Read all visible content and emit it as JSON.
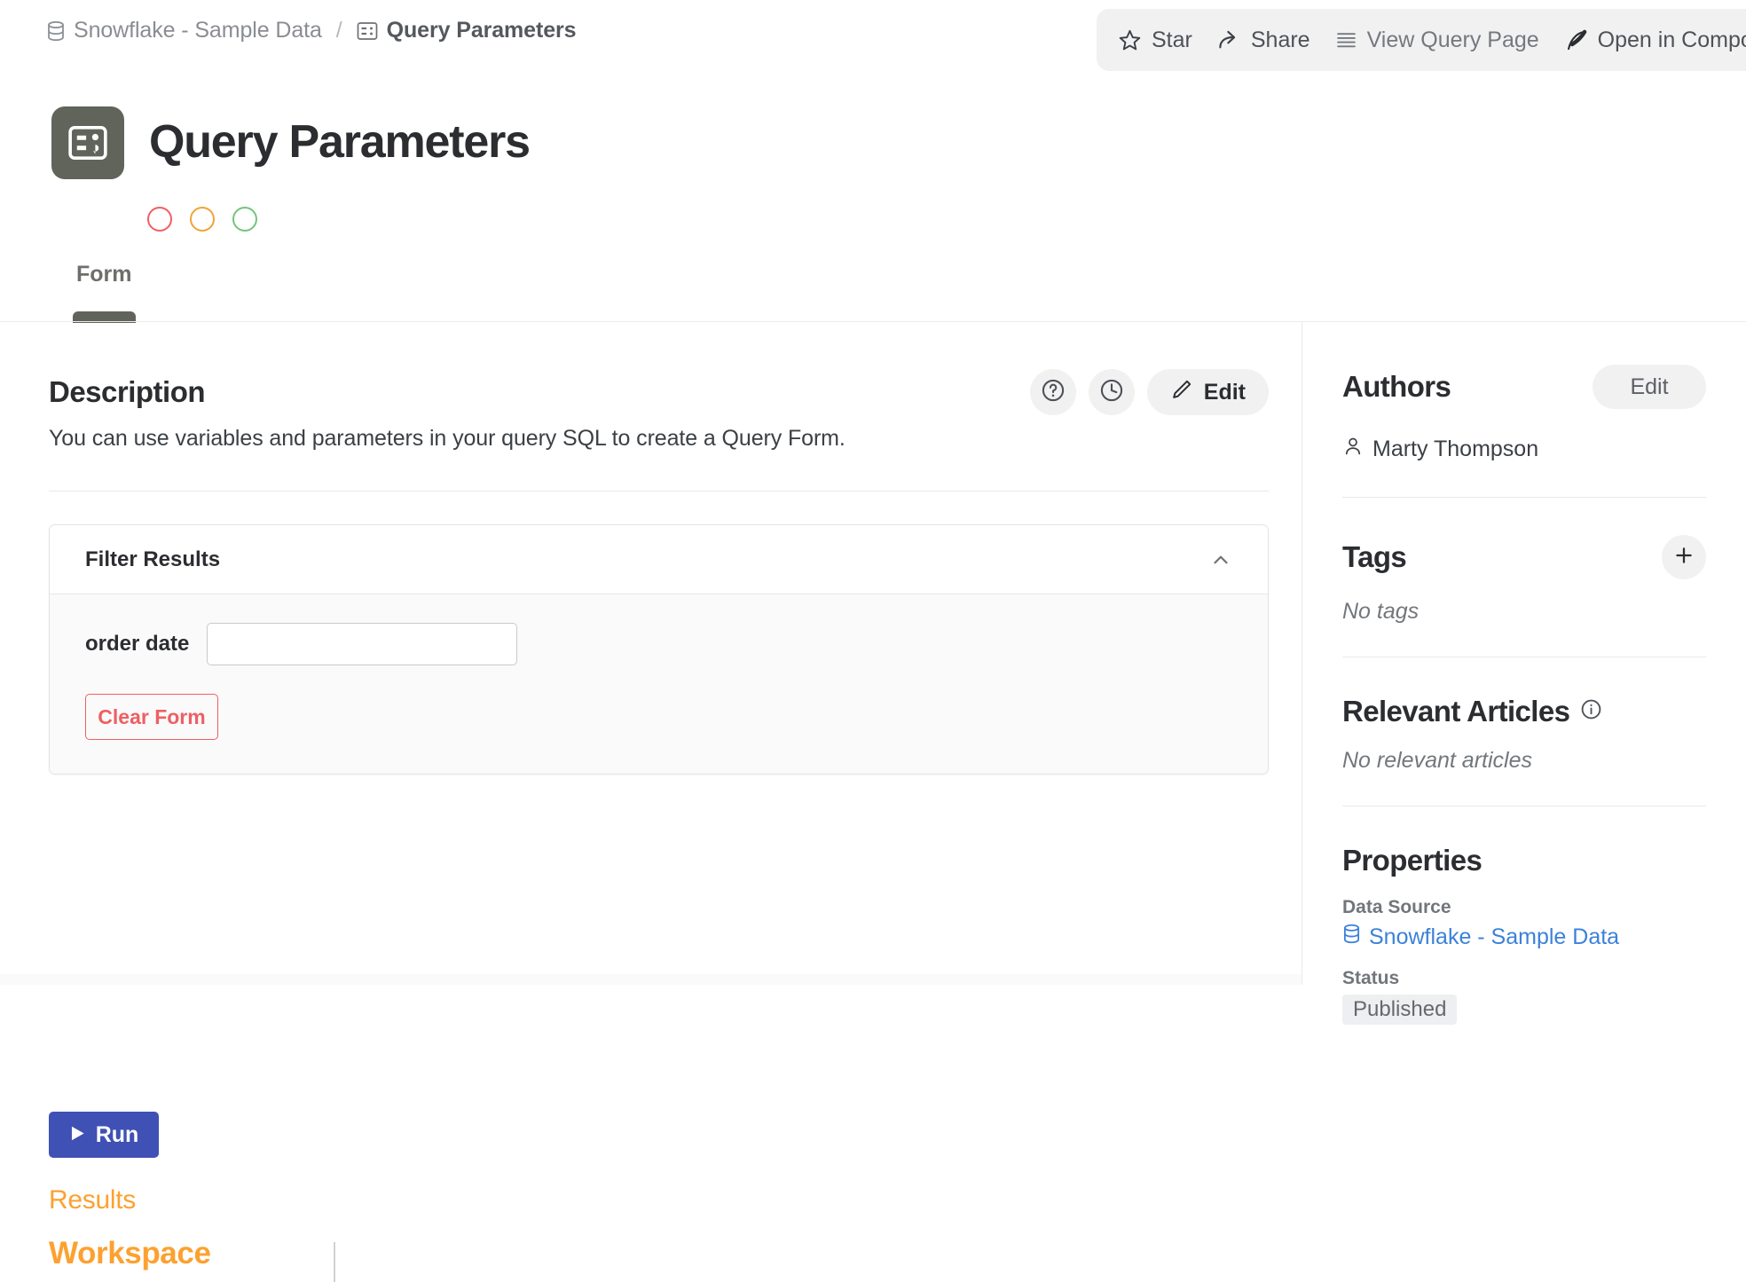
{
  "breadcrumb": {
    "source_icon": "database-icon",
    "source": "Snowflake - Sample Data",
    "separator": "/",
    "current_icon": "query-form-icon",
    "current": "Query Parameters"
  },
  "toolbar": {
    "star": "Star",
    "share": "Share",
    "view_query_page": "View Query Page",
    "open_in_compose": "Open in Compose"
  },
  "header": {
    "icon": "query-form-icon",
    "icon_bg": "#61645a",
    "title": "Query Parameters",
    "dots": [
      {
        "name": "red-circle",
        "color": "#ef5f63"
      },
      {
        "name": "orange-circle",
        "color": "#f0a437"
      },
      {
        "name": "green-circle",
        "color": "#74c47c"
      }
    ]
  },
  "tabs": [
    {
      "label": "Form",
      "active": true
    }
  ],
  "description": {
    "title": "Description",
    "body": "You can use variables and parameters in your query SQL to create a Query Form.",
    "help_icon": "question-circle-icon",
    "history_icon": "clock-icon",
    "edit_icon": "pencil-icon",
    "edit_label": "Edit"
  },
  "filter_card": {
    "title": "Filter Results",
    "collapse_icon": "chevron-up-icon",
    "fields": [
      {
        "label": "order date",
        "value": "",
        "placeholder": ""
      }
    ],
    "clear_label": "Clear Form"
  },
  "run": {
    "icon": "play-icon",
    "label": "Run",
    "color": "#3f51b5"
  },
  "results": {
    "label": "Results",
    "color": "#fca130"
  },
  "workspace": {
    "label": "Workspace",
    "color": "#fca130"
  },
  "sidebar": {
    "authors": {
      "title": "Authors",
      "edit_label": "Edit",
      "people": [
        {
          "icon": "person-icon",
          "name": "Marty Thompson"
        }
      ]
    },
    "tags": {
      "title": "Tags",
      "add_icon": "plus-icon",
      "empty": "No tags"
    },
    "relevant_articles": {
      "title": "Relevant Articles",
      "info_icon": "info-circle-icon",
      "empty": "No relevant articles"
    },
    "properties": {
      "title": "Properties",
      "data_source_label": "Data Source",
      "data_source_icon": "database-icon",
      "data_source_value": "Snowflake - Sample Data",
      "data_source_color": "#3b82d8",
      "status_label": "Status",
      "status_value": "Published"
    }
  }
}
